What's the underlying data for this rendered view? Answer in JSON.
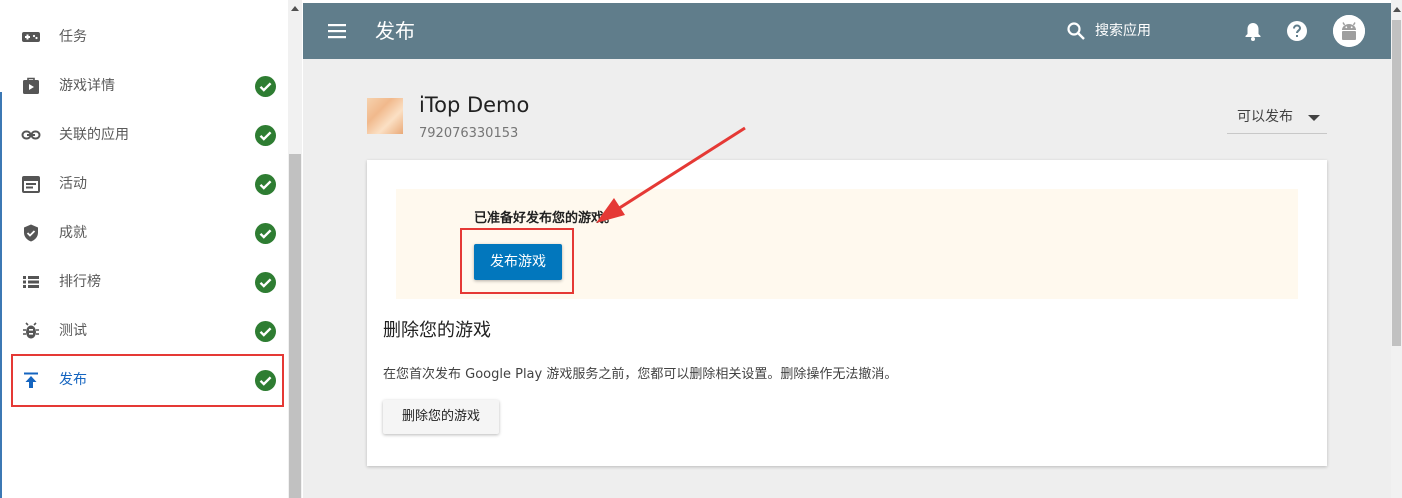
{
  "sidebar": {
    "items": [
      {
        "label": "任务",
        "icon": "gamepad-icon",
        "completed": false,
        "active": false
      },
      {
        "label": "游戏详情",
        "icon": "play-store-icon",
        "completed": true,
        "active": false
      },
      {
        "label": "关联的应用",
        "icon": "link-icon",
        "completed": true,
        "active": false
      },
      {
        "label": "活动",
        "icon": "event-icon",
        "completed": true,
        "active": false
      },
      {
        "label": "成就",
        "icon": "shield-check-icon",
        "completed": true,
        "active": false
      },
      {
        "label": "排行榜",
        "icon": "list-icon",
        "completed": true,
        "active": false
      },
      {
        "label": "测试",
        "icon": "bug-icon",
        "completed": true,
        "active": false
      },
      {
        "label": "发布",
        "icon": "publish-icon",
        "completed": true,
        "active": true
      }
    ]
  },
  "header": {
    "title": "发布",
    "search_label": "搜索应用",
    "icons": [
      "menu-icon",
      "search-icon",
      "bell-icon",
      "help-icon",
      "avatar-icon"
    ]
  },
  "game": {
    "name": "iTop Demo",
    "id": "792076330153",
    "status": "可以发布"
  },
  "publish": {
    "ready_text": "已准备好发布您的游戏。",
    "button_label": "发布游戏"
  },
  "delete": {
    "title": "删除您的游戏",
    "description": "在您首次发布 Google Play 游戏服务之前，您都可以删除相关设置。删除操作无法撤消。",
    "button_label": "删除您的游戏"
  },
  "colors": {
    "header": "#607d8b",
    "primary_button": "#0277bd",
    "check": "#2e7d32",
    "active_text": "#1565c0",
    "annotation": "#e53935",
    "ready_panel": "#fff9ee"
  }
}
